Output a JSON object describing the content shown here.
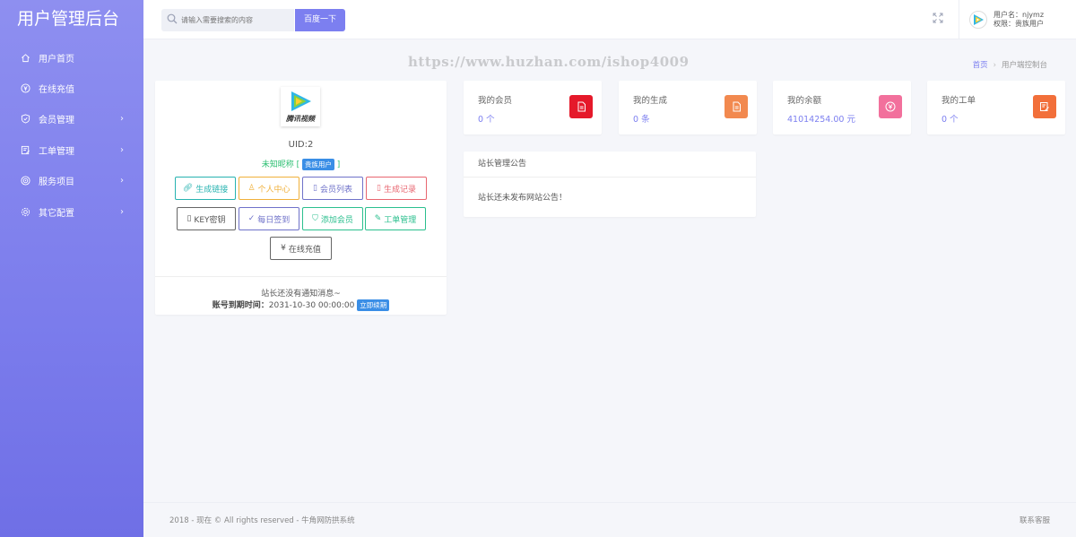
{
  "app": {
    "title": "用户管理后台"
  },
  "sidebar": {
    "items": [
      {
        "label": "用户首页",
        "icon": "home-icon",
        "has_children": false
      },
      {
        "label": "在线充值",
        "icon": "yen-icon",
        "has_children": false
      },
      {
        "label": "会员管理",
        "icon": "shield-icon",
        "has_children": true
      },
      {
        "label": "工单管理",
        "icon": "ticket-icon",
        "has_children": true
      },
      {
        "label": "服务项目",
        "icon": "target-icon",
        "has_children": true
      },
      {
        "label": "其它配置",
        "icon": "gear-icon",
        "has_children": true
      }
    ]
  },
  "header": {
    "search_placeholder": "请输入需要搜索的内容",
    "search_button": "百度一下",
    "user_name": "用户名：njymz",
    "user_role": "权限：贵族用户"
  },
  "watermark": "https://www.huzhan.com/ishop4009",
  "breadcrumb": {
    "home": "首页",
    "current": "用户端控制台"
  },
  "profile": {
    "logo_text": "腾讯视频",
    "uid": "UID:2",
    "nickname": "未知昵称",
    "role_badge": "贵族用户",
    "buttons": {
      "gen_link": "生成链接",
      "personal": "个人中心",
      "members": "会员列表",
      "gen_record": "生成记录",
      "key": "KEY密钥",
      "checkin": "每日签到",
      "add_member": "添加会员",
      "tickets": "工单管理",
      "recharge": "在线充值"
    },
    "notice": "站长还没有通知消息~",
    "expire_label": "账号到期时间：",
    "expire_value": "2031-10-30 00:00:00",
    "renew": "立即续期"
  },
  "stats": [
    {
      "label": "我的会员",
      "value": "0 个",
      "icon": "document-icon",
      "color": "#e5192a"
    },
    {
      "label": "我的生成",
      "value": "0 条",
      "icon": "document-icon",
      "color": "#f2894f"
    },
    {
      "label": "我的余额",
      "value": "41014254.00 元",
      "icon": "yen-icon",
      "color": "#f2709c"
    },
    {
      "label": "我的工单",
      "value": "0 个",
      "icon": "edit-icon",
      "color": "#f26f3a"
    }
  ],
  "announcement": {
    "title": "站长管理公告",
    "body": "站长还未发布网站公告！"
  },
  "footer": {
    "copyright": "2018 - 现在 © All rights reserved - 牛角网防拱系统",
    "contact": "联系客服"
  }
}
